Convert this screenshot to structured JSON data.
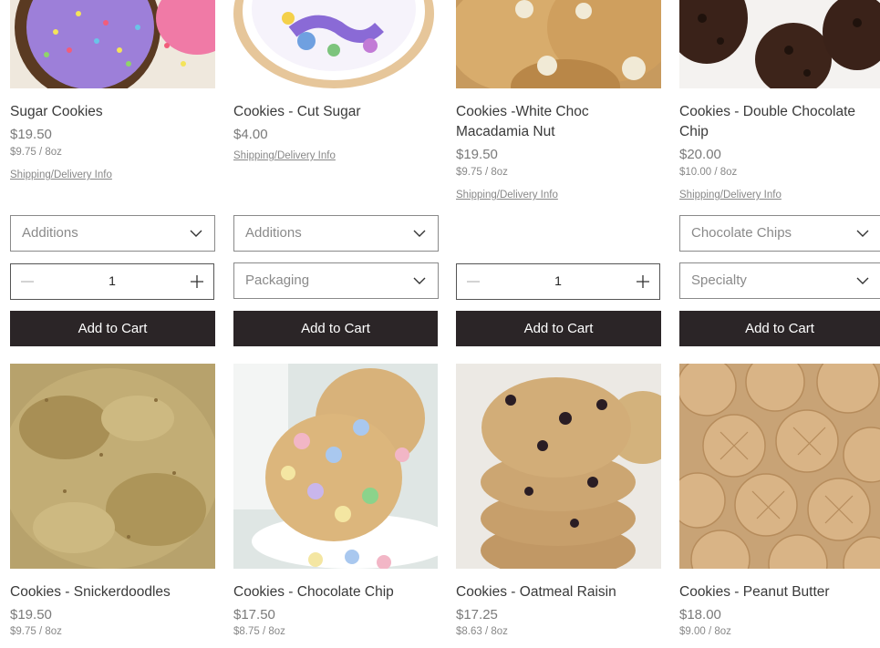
{
  "products_top": [
    {
      "name": "Sugar Cookies",
      "price": "$19.50",
      "unit_price": "$9.75 / 8oz",
      "shipping": "Shipping/Delivery Info",
      "option1": "Additions",
      "quantity": "1",
      "add_to_cart": "Add to Cart"
    },
    {
      "name": "Cookies - Cut Sugar",
      "price": "$4.00",
      "shipping": "Shipping/Delivery Info",
      "option1": "Additions",
      "option2": "Packaging",
      "add_to_cart": "Add to Cart"
    },
    {
      "name": "Cookies -White Choc Macadamia Nut",
      "price": "$19.50",
      "unit_price": "$9.75 / 8oz",
      "shipping": "Shipping/Delivery Info",
      "quantity": "1",
      "add_to_cart": "Add to Cart"
    },
    {
      "name": "Cookies - Double Chocolate Chip",
      "price": "$20.00",
      "unit_price": "$10.00 / 8oz",
      "shipping": "Shipping/Delivery Info",
      "option1": "Chocolate Chips",
      "option2": "Specialty",
      "add_to_cart": "Add to Cart"
    }
  ],
  "products_bottom": [
    {
      "name": "Cookies - Snickerdoodles",
      "price": "$19.50",
      "unit_price": "$9.75 / 8oz"
    },
    {
      "name": "Cookies - Chocolate Chip",
      "price": "$17.50",
      "unit_price": "$8.75 / 8oz"
    },
    {
      "name": "Cookies - Oatmeal Raisin",
      "price": "$17.25",
      "unit_price": "$8.63 / 8oz"
    },
    {
      "name": "Cookies - Peanut Butter",
      "price": "$18.00",
      "unit_price": "$9.00 / 8oz"
    }
  ],
  "colors": {
    "button_bg": "#2b2527",
    "text_muted": "#7a7a7a"
  }
}
